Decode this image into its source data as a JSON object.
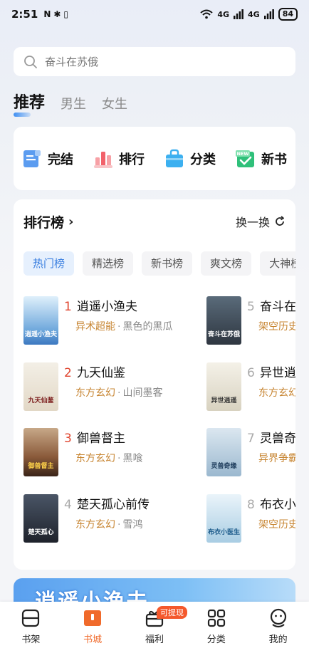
{
  "status_bar": {
    "time": "2:51",
    "left_icons": [
      "N",
      "✱",
      "▯"
    ],
    "signal_label_1": "4G",
    "signal_label_2": "4G",
    "battery": "84"
  },
  "search": {
    "placeholder": "奋斗在苏俄"
  },
  "top_tabs": [
    {
      "label": "推荐",
      "active": true
    },
    {
      "label": "男生",
      "active": false
    },
    {
      "label": "女生",
      "active": false
    }
  ],
  "shortcuts": [
    {
      "label": "完结",
      "icon": "document-icon",
      "color": "#4a90e2"
    },
    {
      "label": "排行",
      "icon": "ranking-icon",
      "color": "#f2616a"
    },
    {
      "label": "分类",
      "icon": "category-bag-icon",
      "color": "#3cb0f0"
    },
    {
      "label": "新书",
      "icon": "new-book-icon",
      "color": "#2fc07a",
      "badge": "NEW"
    }
  ],
  "ranking": {
    "title": "排行榜",
    "refresh_label": "换一换",
    "tabs": [
      {
        "label": "热门榜",
        "active": true
      },
      {
        "label": "精选榜",
        "active": false
      },
      {
        "label": "新书榜",
        "active": false
      },
      {
        "label": "爽文榜",
        "active": false
      },
      {
        "label": "大神榜",
        "active": false
      }
    ],
    "books": [
      {
        "rank": "1",
        "title": "逍遥小渔夫",
        "genre": "异术超能",
        "author": "黑色的黑瓜",
        "cover_text": "逍遥小渔夫",
        "cover_color": "#6fa8dc"
      },
      {
        "rank": "2",
        "title": "九天仙鉴",
        "genre": "东方玄幻",
        "author": "山间墨客",
        "cover_text": "九天仙鉴",
        "cover_color": "#e9e2d6"
      },
      {
        "rank": "3",
        "title": "御兽督主",
        "genre": "东方玄幻",
        "author": "黑喰",
        "cover_text": "御兽督主",
        "cover_color": "#8a5a3a"
      },
      {
        "rank": "4",
        "title": "楚天孤心前传",
        "genre": "东方玄幻",
        "author": "雪鸿",
        "cover_text": "楚天孤心",
        "cover_color": "#2a2f3a"
      },
      {
        "rank": "5",
        "title": "奋斗在苏俄",
        "genre": "架空历史",
        "author": "",
        "cover_text": "奋斗在苏俄",
        "cover_color": "#3a4a5a"
      },
      {
        "rank": "6",
        "title": "异世逍遥",
        "genre": "东方玄幻",
        "author": "",
        "cover_text": "异世逍遥",
        "cover_color": "#e8e4d8"
      },
      {
        "rank": "7",
        "title": "灵兽奇缘",
        "genre": "异界争霸",
        "author": "",
        "cover_text": "灵兽奇缘",
        "cover_color": "#b8cfe0"
      },
      {
        "rank": "8",
        "title": "布衣小医生",
        "genre": "架空历史",
        "author": "",
        "cover_text": "布衣小医生",
        "cover_color": "#cfe3ef"
      }
    ]
  },
  "banner": {
    "text": "逍遥小渔夫"
  },
  "bottom_nav": [
    {
      "label": "书架",
      "icon": "bookshelf-icon",
      "active": false
    },
    {
      "label": "书城",
      "icon": "bookstore-icon",
      "active": true
    },
    {
      "label": "福利",
      "icon": "gift-icon",
      "active": false,
      "badge": "可提现"
    },
    {
      "label": "分类",
      "icon": "grid-icon",
      "active": false
    },
    {
      "label": "我的",
      "icon": "profile-icon",
      "active": false
    }
  ],
  "colors": {
    "accent_blue": "#3a7fe0",
    "accent_orange": "#f06a2b",
    "rank_top": "#e0452f",
    "genre": "#c78532"
  }
}
